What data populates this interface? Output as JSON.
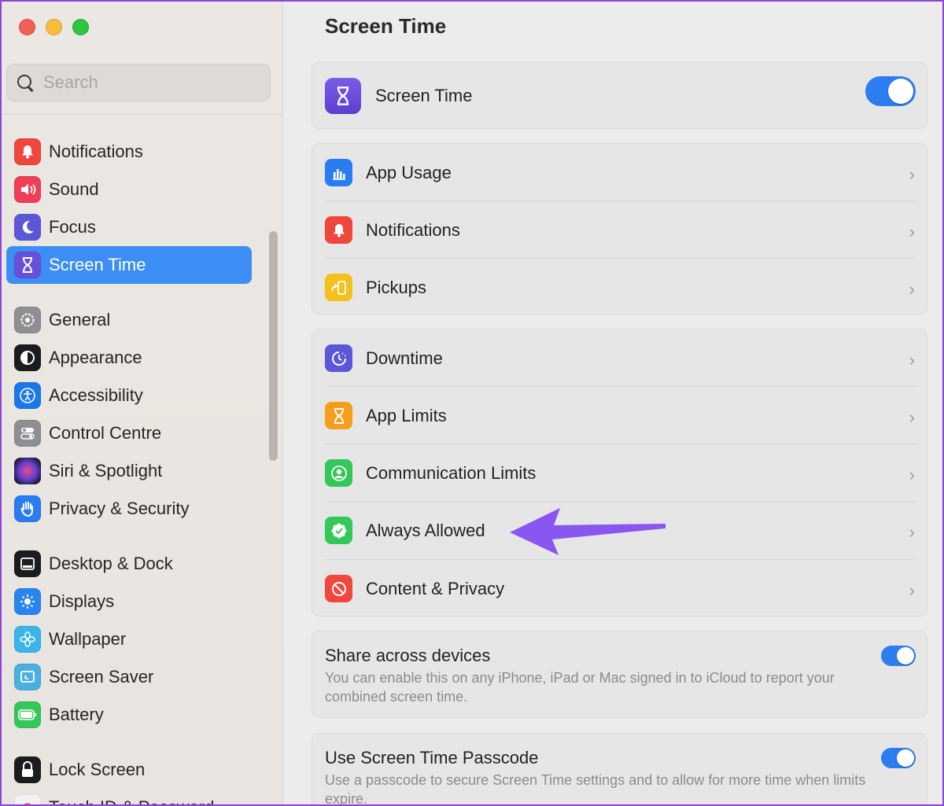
{
  "window": {
    "search_placeholder": "Search",
    "accent_color": "#3c8ef5"
  },
  "sidebar": {
    "group1": [
      {
        "label": "Notifications",
        "icon": "bell-icon",
        "color": "#f0463d"
      },
      {
        "label": "Sound",
        "icon": "speaker-icon",
        "color": "#ef3e56"
      },
      {
        "label": "Focus",
        "icon": "moon-icon",
        "color": "#5b57d6"
      },
      {
        "label": "Screen Time",
        "icon": "hourglass-icon",
        "color": "#6a4fd8",
        "selected": true
      }
    ],
    "group2": [
      {
        "label": "General",
        "icon": "gear-icon",
        "color": "#8e8e93"
      },
      {
        "label": "Appearance",
        "icon": "appearance-icon",
        "color": "#1c1c1e"
      },
      {
        "label": "Accessibility",
        "icon": "accessibility-icon",
        "color": "#1a78e8"
      },
      {
        "label": "Control Centre",
        "icon": "control-centre-icon",
        "color": "#8e8e93"
      },
      {
        "label": "Siri & Spotlight",
        "icon": "siri-icon",
        "color": "#2d2d6a"
      },
      {
        "label": "Privacy & Security",
        "icon": "hand-icon",
        "color": "#2a7df0"
      }
    ],
    "group3": [
      {
        "label": "Desktop & Dock",
        "icon": "dock-icon",
        "color": "#1c1c1e"
      },
      {
        "label": "Displays",
        "icon": "sun-icon",
        "color": "#2a84f0"
      },
      {
        "label": "Wallpaper",
        "icon": "flower-icon",
        "color": "#3ab5e8"
      },
      {
        "label": "Screen Saver",
        "icon": "screen-saver-icon",
        "color": "#4ab0e0"
      },
      {
        "label": "Battery",
        "icon": "battery-icon",
        "color": "#34c759"
      }
    ],
    "group4": [
      {
        "label": "Lock Screen",
        "icon": "lock-icon",
        "color": "#1c1c1e"
      },
      {
        "label": "Touch ID & Password",
        "icon": "fingerprint-icon",
        "color": "#f2f2f2"
      }
    ]
  },
  "main": {
    "title": "Screen Time",
    "screen_time_row": {
      "label": "Screen Time",
      "toggle_on": true
    },
    "usage_rows": [
      {
        "label": "App Usage",
        "icon": "chart-icon",
        "color": "#2a7df0"
      },
      {
        "label": "Notifications",
        "icon": "bell-icon",
        "color": "#f0463d"
      },
      {
        "label": "Pickups",
        "icon": "pickup-icon",
        "color": "#f2c11e"
      }
    ],
    "limit_rows": [
      {
        "label": "Downtime",
        "icon": "downtime-icon",
        "color": "#5b57d6"
      },
      {
        "label": "App Limits",
        "icon": "hourglass-icon",
        "color": "#f59e1b"
      },
      {
        "label": "Communication Limits",
        "icon": "person-icon",
        "color": "#34c759"
      },
      {
        "label": "Always Allowed",
        "icon": "checkmark-seal-icon",
        "color": "#34c759"
      },
      {
        "label": "Content & Privacy",
        "icon": "restricted-icon",
        "color": "#f0463d"
      }
    ],
    "share": {
      "title": "Share across devices",
      "desc": "You can enable this on any iPhone, iPad or Mac signed in to iCloud to report your combined screen time.",
      "toggle_on": true
    },
    "passcode": {
      "title": "Use Screen Time Passcode",
      "desc": "Use a passcode to secure Screen Time settings and to allow for more time when limits expire.",
      "toggle_on": true
    },
    "annotation_arrow_color": "#8a56f0"
  }
}
